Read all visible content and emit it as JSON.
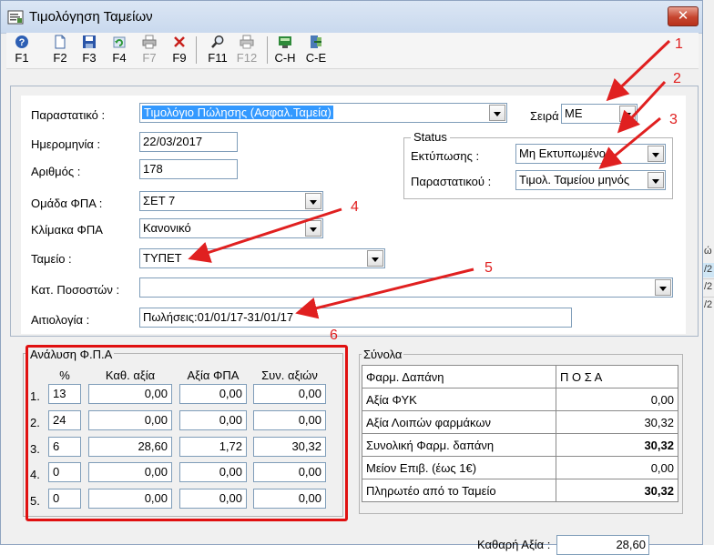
{
  "window": {
    "title": "Τιμολόγηση Ταμείων",
    "close_label": "✕"
  },
  "toolbar": [
    {
      "key": "F1",
      "icon": "help-icon",
      "enabled": true
    },
    {
      "key": "F2",
      "icon": "new-document-icon",
      "enabled": true
    },
    {
      "key": "F3",
      "icon": "save-icon",
      "enabled": true
    },
    {
      "key": "F4",
      "icon": "refresh-icon",
      "enabled": true
    },
    {
      "key": "F7",
      "icon": "print-icon",
      "enabled": false
    },
    {
      "key": "F9",
      "icon": "delete-icon",
      "enabled": true
    },
    {
      "key": "F11",
      "icon": "search-icon",
      "enabled": true
    },
    {
      "key": "F12",
      "icon": "print-preview-icon",
      "enabled": false
    },
    {
      "key": "C-H",
      "icon": "calculator-icon",
      "enabled": true
    },
    {
      "key": "C-E",
      "icon": "exit-icon",
      "enabled": true
    }
  ],
  "form": {
    "document": {
      "label": "Παραστατικό :",
      "value": "Τιμολόγιο Πώλησης (Ασφαλ.Ταμεία)"
    },
    "series": {
      "label": "Σειρά",
      "value": "ΜΕ"
    },
    "date": {
      "label": "Ημερομηνία :",
      "value": "22/03/2017"
    },
    "number": {
      "label": "Αριθμός :",
      "value": "178"
    },
    "vat_group": {
      "label": "Ομάδα ΦΠΑ :",
      "value": "ΣΕΤ 7"
    },
    "vat_scale": {
      "label": "Κλίμακα ΦΠΑ",
      "value": "Κανονικό"
    },
    "fund": {
      "label": "Ταμείο :",
      "value": "ΤΥΠΕΤ"
    },
    "percent_category": {
      "label": "Κατ. Ποσοστών :",
      "value": ""
    },
    "reason": {
      "label": "Αιτιολογία :",
      "value": "Πωλήσεις:01/01/17-31/01/17"
    }
  },
  "status": {
    "title": "Status",
    "printing": {
      "label": "Εκτύπωσης :",
      "value": "Μη Εκτυπωμένο"
    },
    "document": {
      "label": "Παραστατικού :",
      "value": "Τιμολ. Ταμείου μηνός"
    }
  },
  "vat_analysis": {
    "title": "Ανάλυση Φ.Π.Α",
    "headers": [
      "%",
      "Καθ. αξία",
      "Αξία ΦΠΑ",
      "Συν. αξιών"
    ],
    "rows": [
      {
        "idx": "1.",
        "pct": "13",
        "net": "0,00",
        "vat": "0,00",
        "total": "0,00"
      },
      {
        "idx": "2.",
        "pct": "24",
        "net": "0,00",
        "vat": "0,00",
        "total": "0,00"
      },
      {
        "idx": "3.",
        "pct": "6",
        "net": "28,60",
        "vat": "1,72",
        "total": "30,32"
      },
      {
        "idx": "4.",
        "pct": "0",
        "net": "0,00",
        "vat": "0,00",
        "total": "0,00"
      },
      {
        "idx": "5.",
        "pct": "0",
        "net": "0,00",
        "vat": "0,00",
        "total": "0,00"
      }
    ]
  },
  "totals": {
    "title": "Σύνολα",
    "header": {
      "label": "Φαρμ. Δαπάνη",
      "value": "Π Ο Σ Α"
    },
    "rows": [
      {
        "label": "Αξία ΦΥΚ",
        "value": "0,00",
        "bold": false
      },
      {
        "label": "Αξία Λοιπών φαρμάκων",
        "value": "30,32",
        "bold": false
      },
      {
        "label": "Συνολική Φαρμ. δαπάνη",
        "value": "30,32",
        "bold": true
      },
      {
        "label": "Μείον Επιβ. (έως 1€)",
        "value": "0,00",
        "bold": false
      },
      {
        "label": "Πληρωτέο από το Ταμείο",
        "value": "30,32",
        "bold": true
      }
    ],
    "net_value": {
      "label": "Καθαρή Αξία :",
      "value": "28,60"
    }
  },
  "annotations": [
    "1",
    "2",
    "3",
    "4",
    "5",
    "6"
  ],
  "background_list": [
    "ώ",
    "/2",
    "/2",
    "/2"
  ],
  "colors": {
    "annotation": "#e02020",
    "selection": "#3399ff",
    "close": "#c6452f"
  }
}
